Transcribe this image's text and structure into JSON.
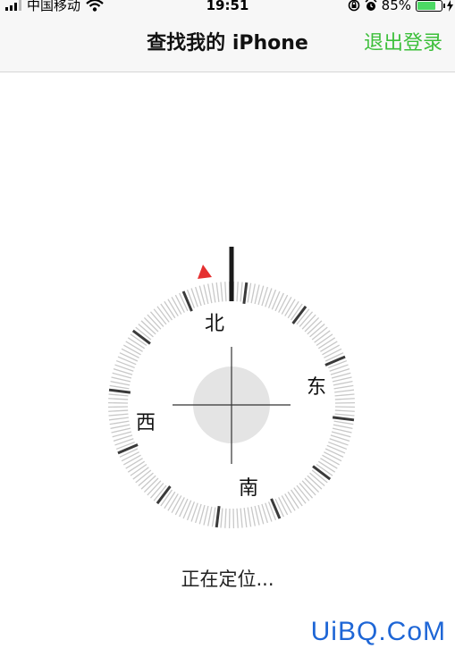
{
  "status_bar": {
    "carrier": "中国移动",
    "time": "19:51",
    "battery_percent": "85%",
    "battery_level": 0.85,
    "icons": [
      "signal-icon",
      "wifi-icon",
      "rotation-lock-icon",
      "alarm-icon",
      "battery-icon",
      "charging-icon"
    ]
  },
  "nav": {
    "title": "查找我的 iPhone",
    "logout_label": "退出登录"
  },
  "compass": {
    "north": "北",
    "east": "东",
    "south": "南",
    "west": "西",
    "rotation_deg": -23,
    "heading_marker_color": "#e53030"
  },
  "status_text": "正在定位...",
  "watermark": "UiBQ.CoM",
  "colors": {
    "accent_green": "#3cbf3a",
    "nav_background": "#f7f7f7",
    "watermark_blue": "#1e66d6"
  }
}
